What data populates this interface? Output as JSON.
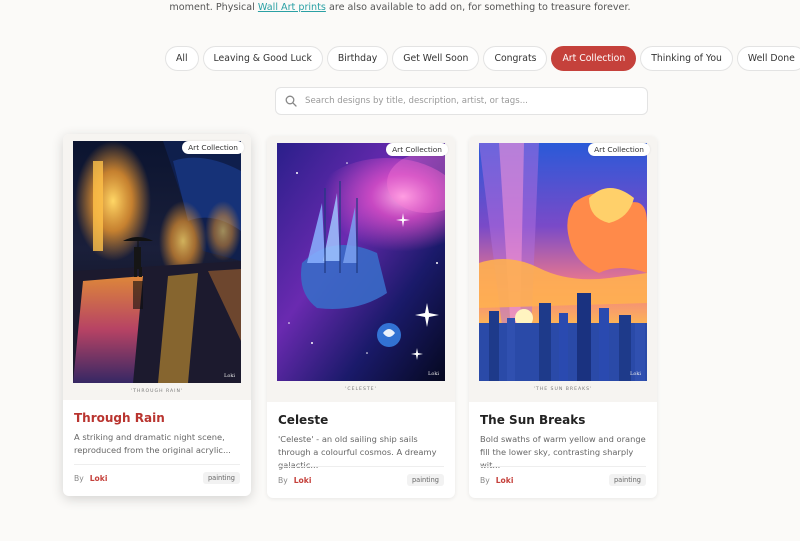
{
  "intro": {
    "before": "moment. Physical ",
    "link": "Wall Art prints",
    "after": " are also available to add on, for something to treasure forever."
  },
  "filters": [
    {
      "label": "All",
      "active": false
    },
    {
      "label": "Leaving & Good Luck",
      "active": false
    },
    {
      "label": "Birthday",
      "active": false
    },
    {
      "label": "Get Well Soon",
      "active": false
    },
    {
      "label": "Congrats",
      "active": false
    },
    {
      "label": "Art Collection",
      "active": true
    },
    {
      "label": "Thinking of You",
      "active": false
    },
    {
      "label": "Well Done",
      "active": false
    }
  ],
  "search": {
    "placeholder": "Search designs by title, description, artist, or tags...",
    "value": ""
  },
  "cards": [
    {
      "badge": "Art Collection",
      "caption": "'THROUGH RAIN'",
      "title": "Through Rain",
      "description": "A striking and dramatic night scene, reproduced from the original acrylic...",
      "by": "By",
      "author": "Loki",
      "tag": "painting",
      "signature": "Loki"
    },
    {
      "badge": "Art Collection",
      "caption": "'CELESTE'",
      "title": "Celeste",
      "description": "'Celeste' - an old sailing ship sails through a colourful cosmos. A dreamy galactic...",
      "by": "By",
      "author": "Loki",
      "tag": "painting",
      "signature": "Loki"
    },
    {
      "badge": "Art Collection",
      "caption": "'THE SUN BREAKS'",
      "title": "The Sun Breaks",
      "description": "Bold swaths of warm yellow and orange fill the lower sky, contrasting sharply wit...",
      "by": "By",
      "author": "Loki",
      "tag": "painting",
      "signature": "Loki"
    }
  ],
  "colors": {
    "accent": "#c5413b",
    "link": "#2aa0a4"
  }
}
